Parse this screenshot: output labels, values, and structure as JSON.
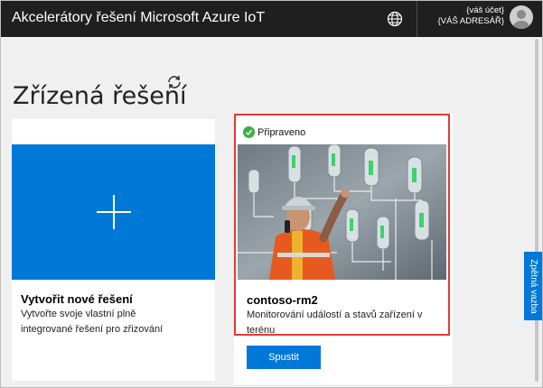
{
  "header": {
    "title": "Akcelerátory řešení Microsoft Azure IoT",
    "globe_icon": "globe-icon",
    "account_name": "{váš účet}",
    "account_directory": "{VÁŠ ADRESÁŘ}",
    "avatar_icon": "user-avatar-icon"
  },
  "page": {
    "title": "Zřízená řešení",
    "refresh_icon": "refresh-icon"
  },
  "cards": {
    "new_solution": {
      "title": "Vytvořit nové řešení",
      "description": "Vytvořte svoje vlastní plně integrované řešení pro zřizování",
      "icon": "plus-icon",
      "tile_color": "#0078d7"
    },
    "solution": {
      "status": "Připraveno",
      "status_color": "#3cb043",
      "name": "contoso-rm2",
      "description": "Monitorování událostí a stavů zařízení v terénu",
      "launch_label": "Spustit",
      "image": "technician-in-hardhat-with-digital-display-photo"
    }
  },
  "feedback": {
    "label": "Zpětná vazba"
  },
  "colors": {
    "accent": "#0078d7",
    "header_bg": "#1f1f1f",
    "highlight": "#e53935"
  }
}
